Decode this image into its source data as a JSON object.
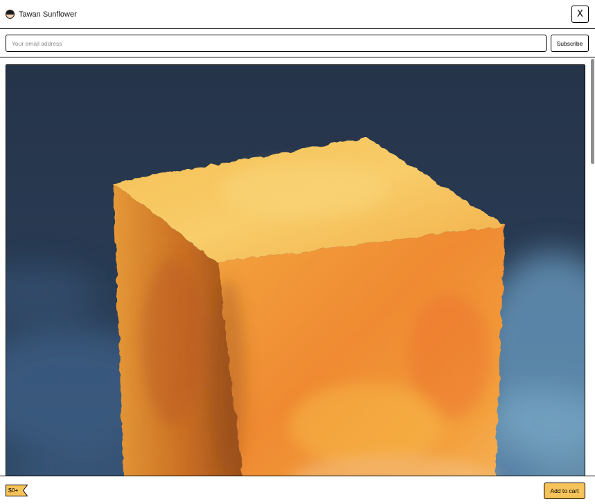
{
  "header": {
    "creator_name": "Tawan Sunflower",
    "avatar_icon": "avatar-icon",
    "close_label": "X"
  },
  "subscribe": {
    "email_placeholder": "Your email address",
    "email_value": "",
    "button_label": "Subscribe"
  },
  "footer": {
    "price_label": "$0+",
    "add_to_cart_label": "Add to cart"
  },
  "colors": {
    "accent": "#f6c35a",
    "background": "#ffffff",
    "border": "#000000",
    "art_background": "#27354a"
  }
}
